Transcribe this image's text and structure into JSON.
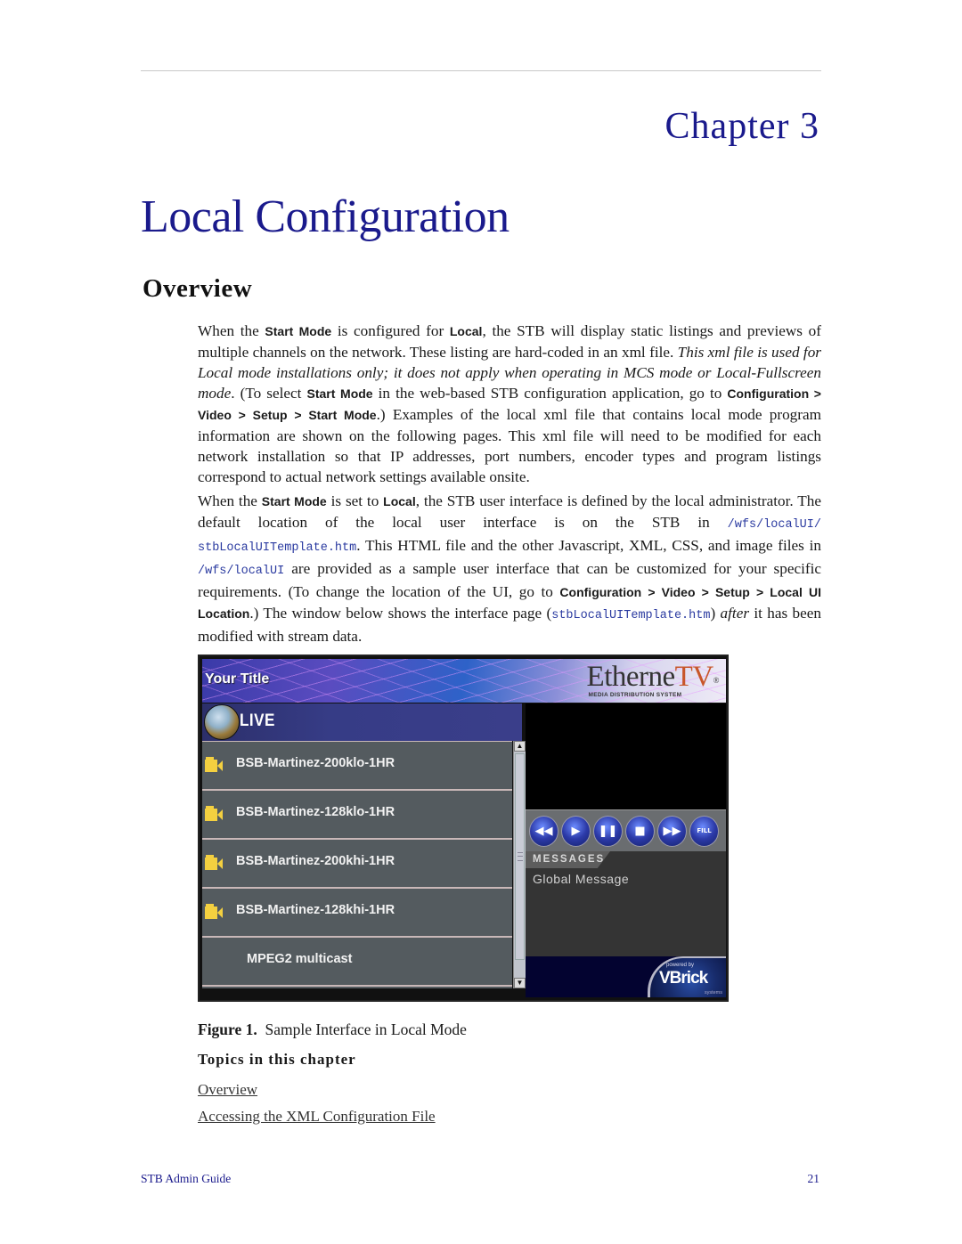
{
  "header": {
    "chapter": "Chapter 3",
    "title": "Local Configuration",
    "section": "Overview"
  },
  "para1": {
    "t1": "When the ",
    "b1": "Start Mode",
    "t2": " is configured for ",
    "b2": "Local",
    "t3": ", the STB will display static listings and previews of multiple channels on the network. These listing are hard-coded in an xml file. ",
    "i1": "This xml file is used for Local mode installations only; it does not apply when operating in MCS mode or Local-Fullscreen mode",
    "t4": ". (To select ",
    "b3": "Start Mode",
    "t5": " in the web-based STB configuration application, go to ",
    "b4": "Configuration > Video > Setup > Start Mode",
    "t6": ".) Examples of the local xml file that contains local mode program information are shown on the following pages. This xml file will need to be modified for each network installation so that IP addresses, port numbers, encoder types and program listings correspond to actual network settings available onsite."
  },
  "para2": {
    "t1": "When the ",
    "b1": "Start Mode",
    "t2": " is set to ",
    "b2": "Local",
    "t3": ", the STB user interface is defined by the local administrator. The default location of the local user interface is on the STB in ",
    "m1": "/wfs/localUI/ stbLocalUITemplate.htm",
    "t4": ". This HTML file and the other Javascript, XML, CSS, and image files in ",
    "m2": "/wfs/localUI",
    "t5": " are provided as a sample user interface that can be customized for your specific requirements. (To change the location of the UI, go to ",
    "b3": "Configuration > Video > Setup > Local UI Location",
    "t6": ".) The window below shows the interface page (",
    "m3": "stbLocalUITemplate.htm",
    "t7": ") ",
    "i1": "after",
    "t8": " it has been modified with stream data."
  },
  "stb": {
    "title": "Your Title",
    "logo_main": "Etherne",
    "logo_tv": "TV",
    "logo_reg": "®",
    "logo_sub": "MEDIA DISTRIBUTION SYSTEM",
    "section_label": "LIVE",
    "channels": [
      {
        "label": "BSB-Martinez-200klo-1HR",
        "icon": "camera-icon"
      },
      {
        "label": "BSB-Martinez-128klo-1HR",
        "icon": "camera-icon"
      },
      {
        "label": "BSB-Martinez-200khi-1HR",
        "icon": "camera-icon"
      },
      {
        "label": "BSB-Martinez-128khi-1HR",
        "icon": "camera-icon"
      },
      {
        "label": "MPEG2 multicast",
        "icon": null
      }
    ],
    "scroll_up": "▲",
    "scroll_down": "▼",
    "controls": {
      "rewind": "◀◀",
      "play": "▶",
      "pause": "❚❚",
      "stop": "■",
      "fast_forward": "▶▶",
      "fill": "FILL"
    },
    "messages_label": "MESSAGES",
    "message_text": "Global Message",
    "powered_by": "powered by",
    "vbrick": "VBrick",
    "vbrick_sub": "systems"
  },
  "figure": {
    "label": "Figure 1.",
    "caption": "Sample Interface in Local Mode"
  },
  "topics": {
    "heading": "Topics in this chapter",
    "links": [
      "Overview",
      "Accessing the XML Configuration File"
    ]
  },
  "footer": {
    "guide": "STB Admin Guide",
    "page": "21"
  }
}
